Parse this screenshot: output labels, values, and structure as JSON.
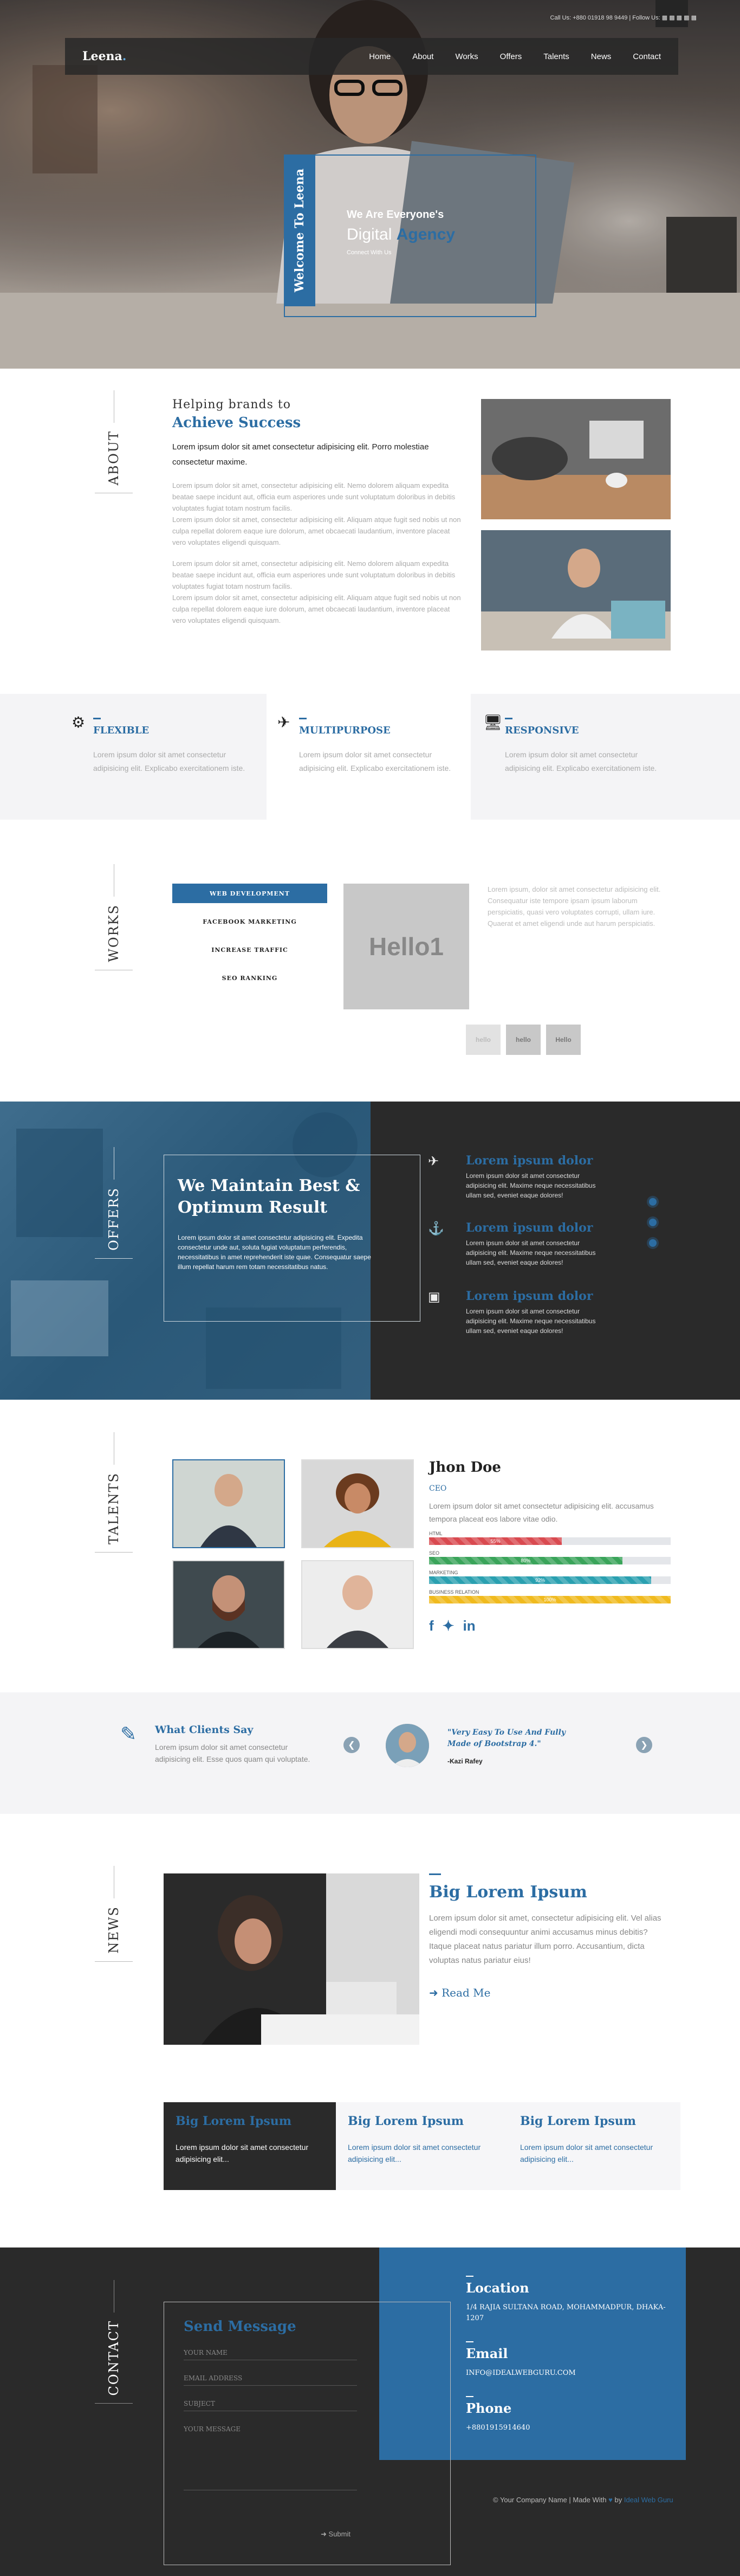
{
  "topbar": {
    "contact": "Call Us: +880 01918 98 9449 | Follow Us:",
    "social_icons": [
      "facebook-icon",
      "twitter-icon",
      "pinterest-icon",
      "instagram-icon",
      "linkedin-icon"
    ]
  },
  "brand": {
    "logo_main": "Leena",
    "logo_dot": "."
  },
  "nav": {
    "items": [
      "Home",
      "About",
      "Works",
      "Offers",
      "Talents",
      "News",
      "Contact"
    ]
  },
  "hero": {
    "vertical": "Welcome To Leena",
    "line1": "We Are Everyone's",
    "line2a": "Digital ",
    "line2b": "Agency",
    "line3": "Connect With Us"
  },
  "about": {
    "side": "About",
    "h1": "Helping brands to",
    "h2": "Achieve Success",
    "lead": "Lorem ipsum dolor sit amet consectetur adipisicing elit. Porro molestiae consectetur maxime.",
    "p1": "Lorem ipsum dolor sit amet, consectetur adipisicing elit. Nemo dolorem aliquam expedita beatae saepe incidunt aut, officia eum asperiores unde sunt voluptatum doloribus in debitis voluptates fugiat totam nostrum facilis.",
    "p2": "Lorem ipsum dolor sit amet, consectetur adipisicing elit. Aliquam atque fugit sed nobis ut non culpa repellat dolorem eaque iure dolorum, amet obcaecati laudantium, inventore placeat vero voluptates eligendi quisquam.",
    "p3": "Lorem ipsum dolor sit amet, consectetur adipisicing elit. Nemo dolorem aliquam expedita beatae saepe incidunt aut, officia eum asperiores unde sunt voluptatum doloribus in debitis voluptates fugiat totam nostrum facilis.",
    "p4": "Lorem ipsum dolor sit amet, consectetur adipisicing elit. Aliquam atque fugit sed nobis ut non culpa repellat dolorem eaque iure dolorum, amet obcaecati laudantium, inventore placeat vero voluptates eligendi quisquam."
  },
  "features": [
    {
      "icon": "gear-icon",
      "title": "Flexible",
      "text": "Lorem ipsum dolor sit amet consectetur adipisicing elit. Explicabo exercitationem iste."
    },
    {
      "icon": "plane-icon",
      "title": "Multipurpose",
      "text": "Lorem ipsum dolor sit amet consectetur adipisicing elit. Explicabo exercitationem iste."
    },
    {
      "icon": "monitor-icon",
      "title": "Responsive",
      "text": "Lorem ipsum dolor sit amet consectetur adipisicing elit. Explicabo exercitationem iste."
    }
  ],
  "works": {
    "side": "Works",
    "tabs": [
      "Web Development",
      "Facebook Marketing",
      "Increase Traffic",
      "SEO Ranking"
    ],
    "preview": "Hello1",
    "copy": "Lorem ipsum, dolor sit amet consectetur adipisicing elit. Consequatur iste tempore ipsam ipsum laborum perspiciatis, quasi vero voluptates corrupti, ullam iure. Quaerat et amet eligendi unde aut harum perspiciatis.",
    "thumbs": [
      "hello",
      "hello",
      "Hello"
    ]
  },
  "offers": {
    "side": "Offers",
    "title1": "We Maintain Best &",
    "title2": "Optimum Result",
    "text": "Lorem ipsum dolor sit amet consectetur adipisicing elit. Expedita consectetur unde aut, soluta fugiat voluptatum perferendis, necessitatibus in amet reprehenderit iste quae. Consequatur saepe illum repellat harum rem totam necessitatibus natus.",
    "items": [
      {
        "icon": "plane-icon",
        "title": "Lorem ipsum dolor",
        "text": "Lorem ipsum dolor sit amet consectetur adipisicing elit. Maxime neque necessitatibus ullam sed, eveniet eaque dolores!"
      },
      {
        "icon": "ship-icon",
        "title": "Lorem ipsum dolor",
        "text": "Lorem ipsum dolor sit amet consectetur adipisicing elit. Maxime neque necessitatibus ullam sed, eveniet eaque dolores!"
      },
      {
        "icon": "bus-icon",
        "title": "Lorem ipsum dolor",
        "text": "Lorem ipsum dolor sit amet consectetur adipisicing elit. Maxime neque necessitatibus ullam sed, eveniet eaque dolores!"
      }
    ]
  },
  "talents": {
    "side": "Talents",
    "name": "Jhon Doe",
    "role": "CEO",
    "bio": "Lorem ipsum dolor sit amet consectetur adipisicing elit. accusamus tempora placeat eos labore vitae odio.",
    "skills": [
      {
        "label": "HTML",
        "value": 55,
        "text": "55%",
        "color": "#d94a50"
      },
      {
        "label": "SEO",
        "value": 80,
        "text": "80%",
        "color": "#3aa45a"
      },
      {
        "label": "Marketing",
        "value": 92,
        "text": "92%",
        "color": "#2aa0b0"
      },
      {
        "label": "Business Relation",
        "value": 100,
        "text": "100%",
        "color": "#f0ba1e"
      }
    ],
    "social_icons": [
      "facebook-icon",
      "twitter-icon",
      "linkedin-icon"
    ]
  },
  "clients": {
    "title": "What Clients Say",
    "text": "Lorem ipsum dolor sit amet consectetur adipisicing elit. Esse quos quam qui voluptate.",
    "quote": "\"Very Easy To Use And Fully Made of Bootstrap 4.\"",
    "author": "-Kazi Rafey"
  },
  "news": {
    "side": "News",
    "title": "Big Lorem Ipsum",
    "text": "Lorem ipsum dolor sit amet, consectetur adipisicing elit. Vel alias eligendi modi consequuntur animi accusamus minus debitis? Itaque placeat natus pariatur illum porro. Accusantium, dicta voluptas natus pariatur eius!",
    "readmore": "Read Me",
    "cards": [
      {
        "title": "Big Lorem Ipsum",
        "text": "Lorem ipsum dolor sit amet consectetur adipisicing elit..."
      },
      {
        "title": "Big Lorem Ipsum",
        "text": "Lorem ipsum dolor sit amet consectetur adipisicing elit..."
      },
      {
        "title": "Big Lorem Ipsum",
        "text": "Lorem ipsum dolor sit amet consectetur adipisicing elit..."
      }
    ]
  },
  "contact": {
    "side": "Contact",
    "form_title": "Send Message",
    "fields": [
      "Your Name",
      "Email Address",
      "Subject",
      "Your Message"
    ],
    "submit": "Submit",
    "location_title": "Location",
    "location": "1/4 Rajia Sultana Road, Mohammadpur, Dhaka-1207",
    "email_title": "Email",
    "email": "info@idealwebguru.com",
    "phone_title": "Phone",
    "phone": "+8801915914640",
    "copyright": "© Your Company Name | Made With",
    "heart_icon": "heart-icon",
    "by": "by",
    "credit": "Ideal Web Guru"
  }
}
